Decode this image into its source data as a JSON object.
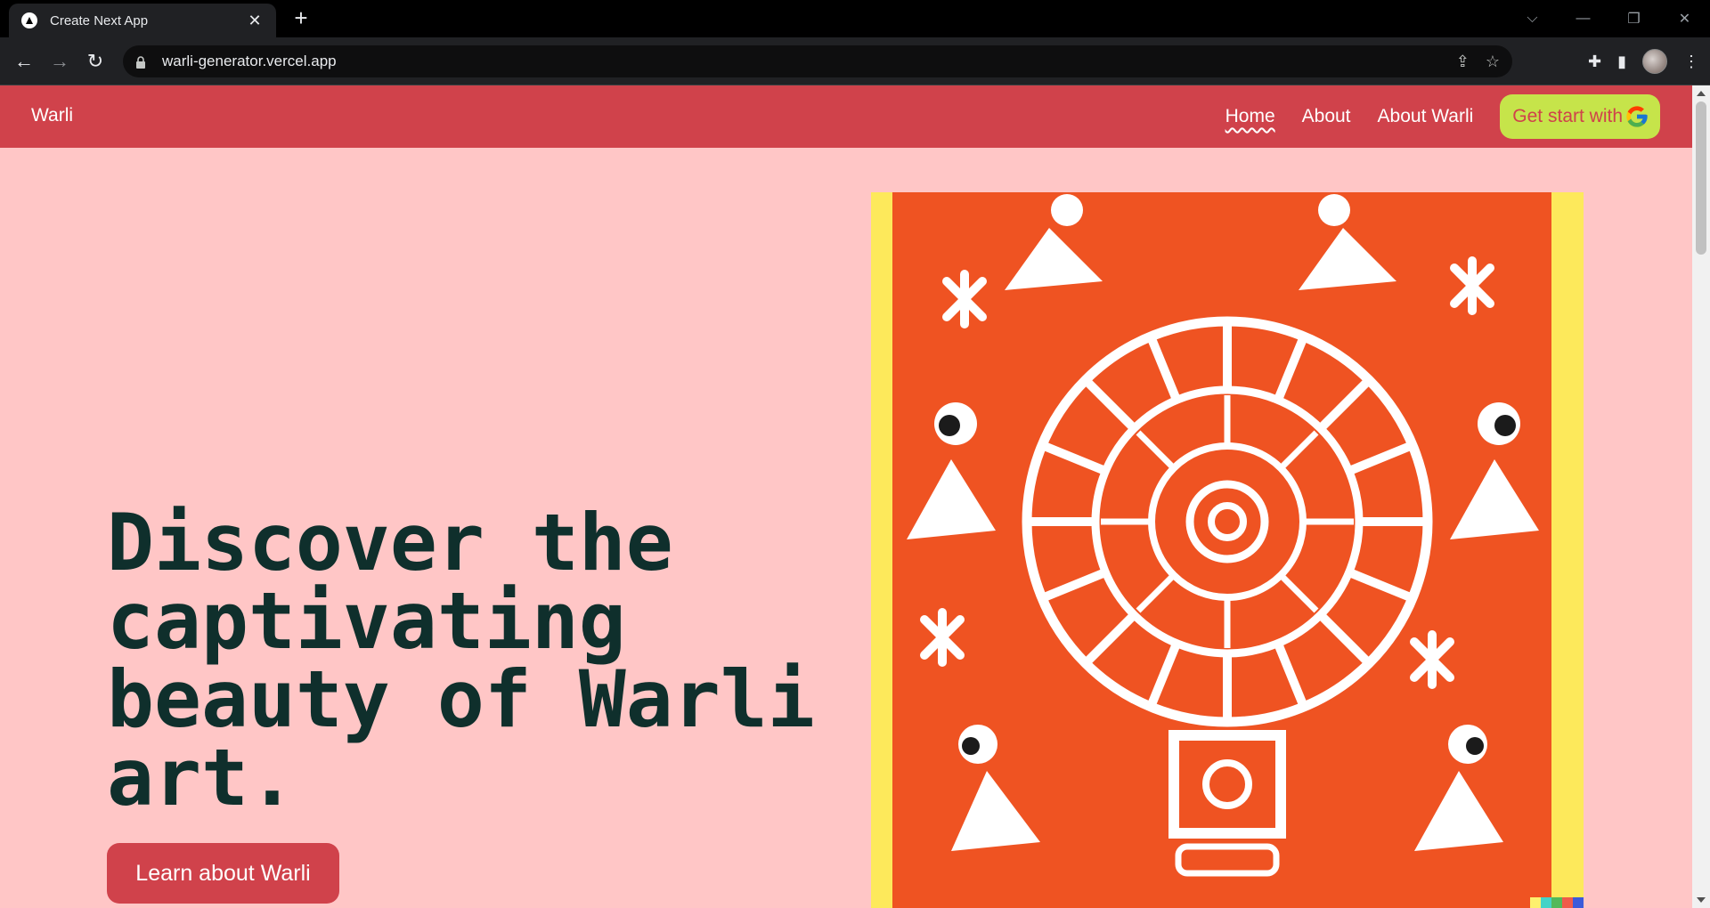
{
  "browser": {
    "tab_title": "Create Next App",
    "tab_close": "✕",
    "new_tab": "+",
    "url": "warli-generator.vercel.app"
  },
  "navbar": {
    "brand": "Warli",
    "links": [
      {
        "label": "Home",
        "active": true
      },
      {
        "label": "About",
        "active": false
      },
      {
        "label": "About Warli",
        "active": false
      }
    ],
    "cta_label": "Get start with"
  },
  "hero": {
    "title": "Discover the captivating beauty of Warli art.",
    "button_label": "Learn about Warli"
  },
  "colors": {
    "navbar": "#d0424b",
    "page_bg": "#ffc6c6",
    "cta_bg": "#c6e44a",
    "title": "#0f2f2c",
    "art_bg": "#ef5322",
    "art_border": "#fde95b"
  }
}
